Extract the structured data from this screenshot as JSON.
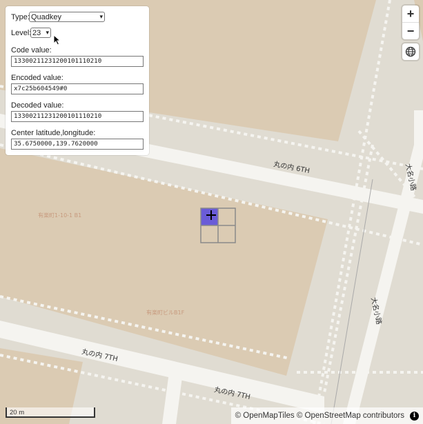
{
  "panel": {
    "type_label": "Type:",
    "type_value": "Quadkey",
    "level_label": "Level:",
    "level_value": "23",
    "code_label": "Code value:",
    "code_value": "13300211231200101110210",
    "encoded_label": "Encoded value:",
    "encoded_value": "x7c25b604549#0",
    "decoded_label": "Decoded value:",
    "decoded_value": "13300211231200101110210",
    "center_label": "Center latitude,longitude:",
    "center_value": "35.6750000,139.7620000"
  },
  "map": {
    "road_labels": [
      "丸の内 6TH",
      "丸の内 7TH",
      "丸の内 7TH",
      "大名小路",
      "大名小路"
    ],
    "building_labels": [
      "有楽町1-10-1 B1",
      "有楽町ビルB1F"
    ],
    "grid_highlight_color": "#6a5cd8"
  },
  "controls": {
    "zoom_in": "+",
    "zoom_out": "−"
  },
  "scale": "20 m",
  "attribution": "© OpenMapTiles © OpenStreetMap contributors",
  "info_icon": "i"
}
